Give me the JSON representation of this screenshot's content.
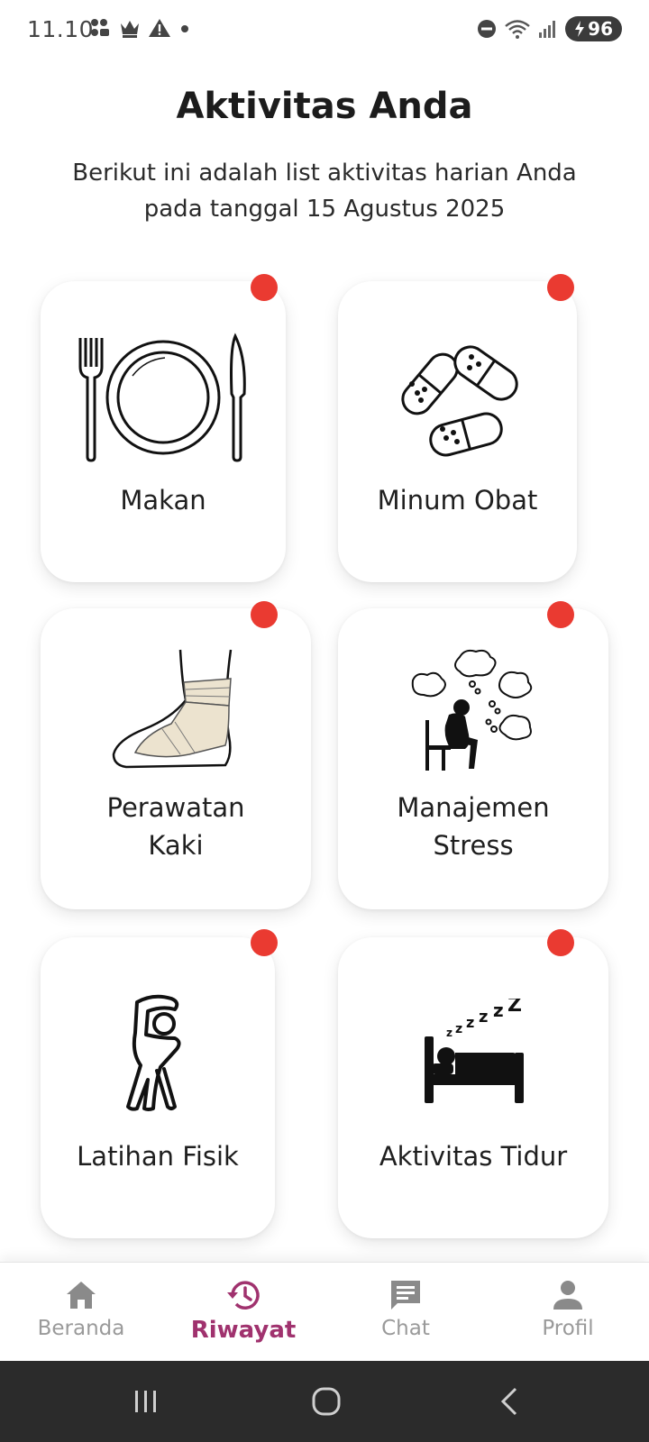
{
  "status_bar": {
    "time": "11.10",
    "battery": "96"
  },
  "header": {
    "title": "Aktivitas Anda",
    "subtitle": "Berikut ini adalah list aktivitas harian Anda pada tanggal 15 Agustus 2025"
  },
  "activities": [
    {
      "label": "Makan",
      "icon": "plate-cutlery-icon"
    },
    {
      "label": "Minum Obat",
      "icon": "pills-icon"
    },
    {
      "label": "Perawatan Kaki",
      "icon": "bandaged-foot-icon"
    },
    {
      "label": "Manajemen Stress",
      "icon": "stressed-person-icon"
    },
    {
      "label": "Latihan Fisik",
      "icon": "stretching-person-icon"
    },
    {
      "label": "Aktivitas Tidur",
      "icon": "sleeping-bed-icon"
    }
  ],
  "bottom_nav": {
    "items": [
      {
        "label": "Beranda",
        "icon": "home-icon"
      },
      {
        "label": "Riwayat",
        "icon": "history-icon"
      },
      {
        "label": "Chat",
        "icon": "chat-icon"
      },
      {
        "label": "Profil",
        "icon": "person-icon"
      }
    ],
    "active": "Riwayat"
  },
  "colors": {
    "accent": "#a0326e",
    "notification_dot": "#ea3a31",
    "inactive": "#9a9a9a"
  }
}
